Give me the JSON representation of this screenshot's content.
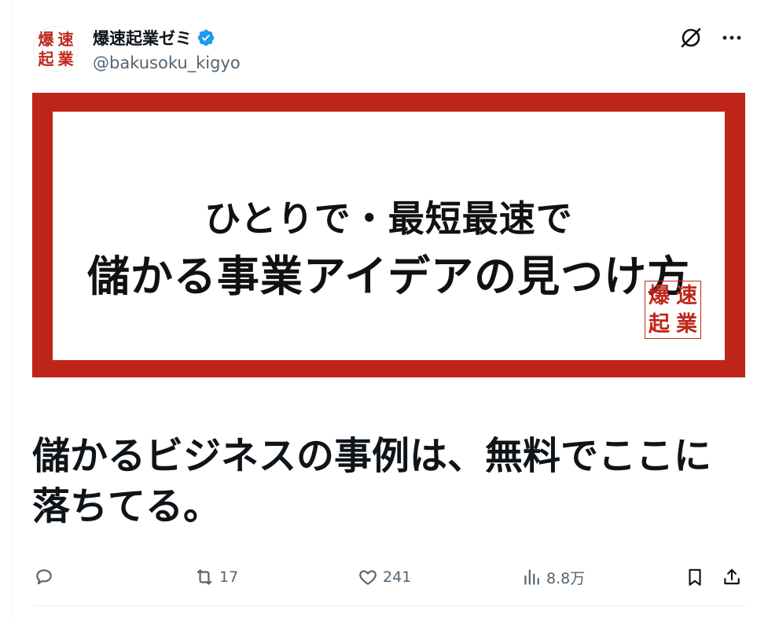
{
  "account": {
    "display_name": "爆速起業ゼミ",
    "handle": "@bakusoku_kigyo",
    "verified_color": "#1d9bf0",
    "avatar_seal": [
      "爆",
      "速",
      "起",
      "業"
    ]
  },
  "header_actions": {
    "grok_icon": "grok-icon",
    "more_icon": "more-icon"
  },
  "banner": {
    "line1": "ひとりで・最短最速で",
    "line2": "儲かる事業アイデアの見つけ方",
    "seal": [
      "爆",
      "速",
      "起",
      "業"
    ],
    "frame_color": "#bf2418"
  },
  "tweet": {
    "text": "儲かるビジネスの事例は、無料でここに落ちてる。"
  },
  "metrics": {
    "reply_count": "",
    "retweet_count": "17",
    "like_count": "241",
    "view_count": "8.8万"
  }
}
